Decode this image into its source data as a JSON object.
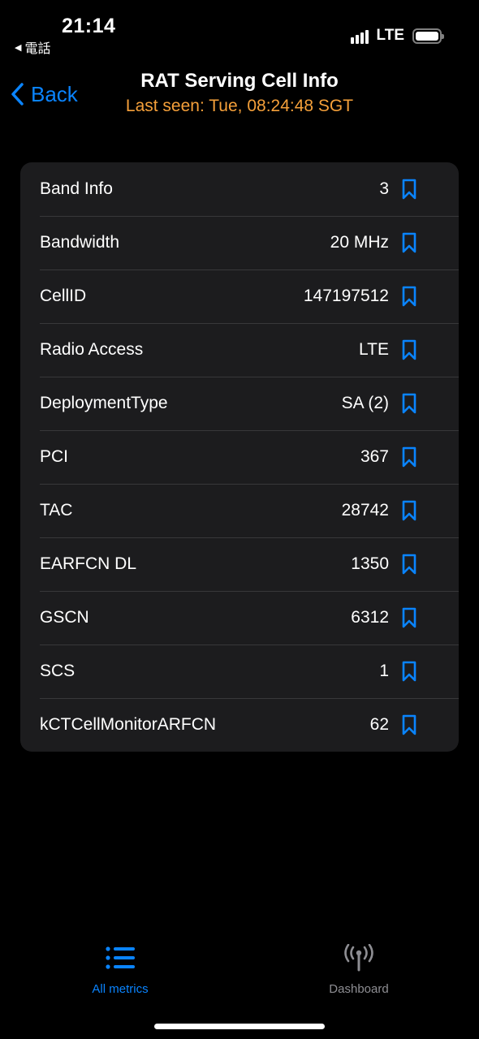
{
  "status_bar": {
    "time": "21:14",
    "back_app": "電話",
    "network": "LTE",
    "signal_bars": 4,
    "battery_level": 1.0
  },
  "nav": {
    "back_label": "Back",
    "title": "RAT Serving Cell Info",
    "subtitle": "Last seen: Tue, 08:24:48 SGT"
  },
  "rows": [
    {
      "label": "Band Info",
      "value": "3"
    },
    {
      "label": "Bandwidth",
      "value": "20 MHz"
    },
    {
      "label": "CellID",
      "value": "147197512"
    },
    {
      "label": "Radio Access",
      "value": "LTE"
    },
    {
      "label": "DeploymentType",
      "value": "SA (2)"
    },
    {
      "label": "PCI",
      "value": "367"
    },
    {
      "label": "TAC",
      "value": "28742"
    },
    {
      "label": "EARFCN DL",
      "value": "1350"
    },
    {
      "label": "GSCN",
      "value": "6312"
    },
    {
      "label": "SCS",
      "value": "1"
    },
    {
      "label": "kCTCellMonitorARFCN",
      "value": "62"
    }
  ],
  "tabs": {
    "all_metrics": "All metrics",
    "dashboard": "Dashboard"
  },
  "colors": {
    "accent": "#0a84ff",
    "subtitle": "#f5a03a",
    "card": "#1c1c1e",
    "inactive": "#8e8e93"
  },
  "icons": {
    "row_action": "bookmark-icon",
    "tab_all_metrics": "list-icon",
    "tab_dashboard": "antenna-icon"
  }
}
